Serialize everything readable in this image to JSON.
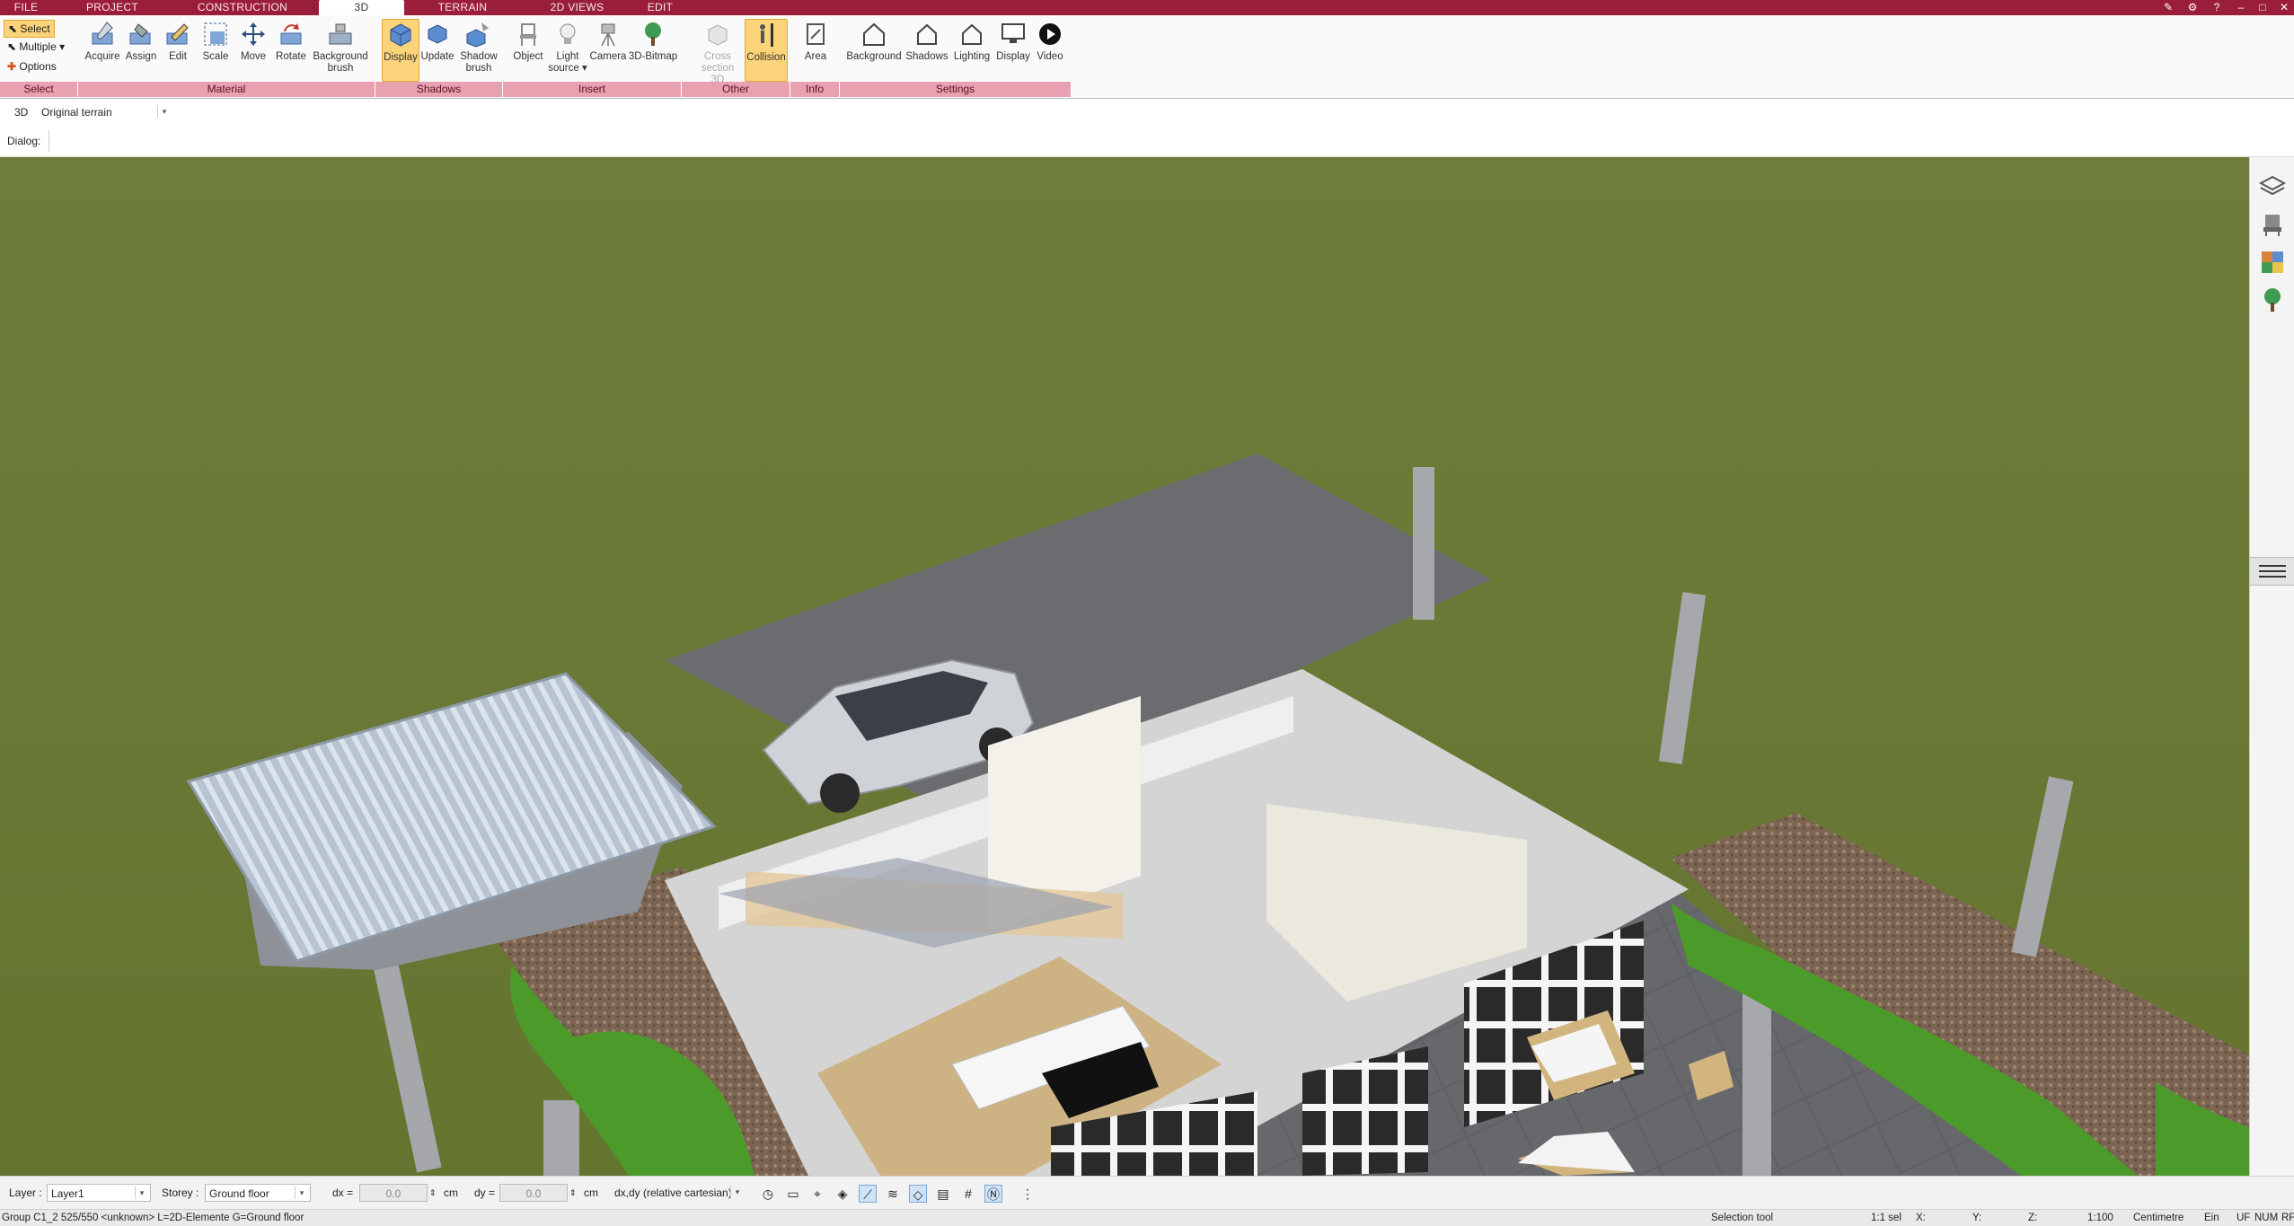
{
  "tabs": [
    {
      "label": "FILE"
    },
    {
      "label": "PROJECT"
    },
    {
      "label": "CONSTRUCTION"
    },
    {
      "label": "3D"
    },
    {
      "label": "TERRAIN"
    },
    {
      "label": "2D VIEWS"
    },
    {
      "label": "EDIT"
    }
  ],
  "ribbon": {
    "select_group": {
      "select": "Select",
      "multiple": "Multiple",
      "options": "Options",
      "label": "Select"
    },
    "material": {
      "label": "Material",
      "acquire": "Acquire",
      "assign": "Assign",
      "edit": "Edit",
      "scale": "Scale",
      "move": "Move",
      "rotate": "Rotate",
      "background_brush_1": "Background",
      "background_brush_2": "brush"
    },
    "shadows": {
      "label": "Shadows",
      "display": "Display",
      "update": "Update",
      "shadow_brush_1": "Shadow",
      "shadow_brush_2": "brush"
    },
    "insert": {
      "label": "Insert",
      "object": "Object",
      "light_source_1": "Light",
      "light_source_2": "source",
      "camera": "Camera",
      "bitmap": "3D-Bitmap"
    },
    "other": {
      "label": "Other",
      "cross_section_1": "Cross",
      "cross_section_2": "section 3D",
      "collision": "Collision"
    },
    "info": {
      "label": "Info",
      "area": "Area"
    },
    "settings": {
      "label": "Settings",
      "background": "Background",
      "shadows": "Shadows",
      "lighting": "Lighting",
      "display": "Display",
      "video": "Video"
    }
  },
  "view_row": {
    "mode": "3D",
    "terrain": "Original terrain"
  },
  "dialog_row": {
    "label": "Dialog:"
  },
  "bottom_toolbar": {
    "layer_label": "Layer :",
    "layer_value": "Layer1",
    "storey_label": "Storey :",
    "storey_value": "Ground floor",
    "dx_label": "dx =",
    "dx_value": "0.0",
    "dx_unit": "cm",
    "dy_label": "dy =",
    "dy_value": "0.0",
    "dy_unit": "cm",
    "coord_mode": "dx,dy (relative cartesian)"
  },
  "status": {
    "left": "Group C1_2 525/550 <unknown> L=2D-Elemente G=Ground floor",
    "tool": "Selection tool",
    "sel": "1:1 sel",
    "x": "X:",
    "y": "Y:",
    "z": "Z:",
    "scale": "1:100",
    "unit": "Centimetre",
    "ein": "Ein",
    "uf": "UF",
    "num": "NUM",
    "rf": "RF"
  },
  "colors": {
    "brand": "#9a1d3a",
    "group_label": "#e7a1b1",
    "active_button": "#fbd37a"
  }
}
